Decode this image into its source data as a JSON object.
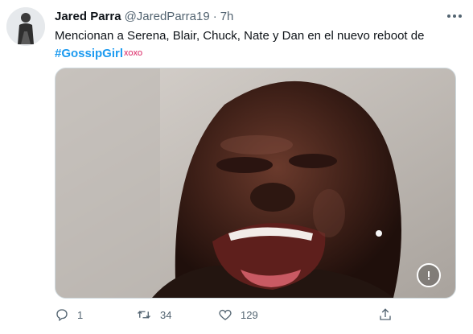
{
  "tweet": {
    "author": {
      "name": "Jared Parra",
      "handle": "@JaredParra19",
      "separator": "·",
      "time": "7h"
    },
    "text": "Mencionan a Serena, Blair, Chuck, Nate y Dan en el nuevo reboot de",
    "hashtag": "#GossipGirl",
    "hashflag": "XOXO",
    "media": {
      "type": "gif",
      "icon": "gif-alert-icon"
    },
    "actions": {
      "reply": {
        "icon": "reply-icon",
        "count": "1"
      },
      "retweet": {
        "icon": "retweet-icon",
        "count": "34"
      },
      "like": {
        "icon": "heart-icon",
        "count": "129"
      },
      "share": {
        "icon": "share-icon"
      }
    },
    "colors": {
      "link": "#1d9bf0",
      "secondary_text": "#536471",
      "primary_text": "#0f1419"
    }
  }
}
